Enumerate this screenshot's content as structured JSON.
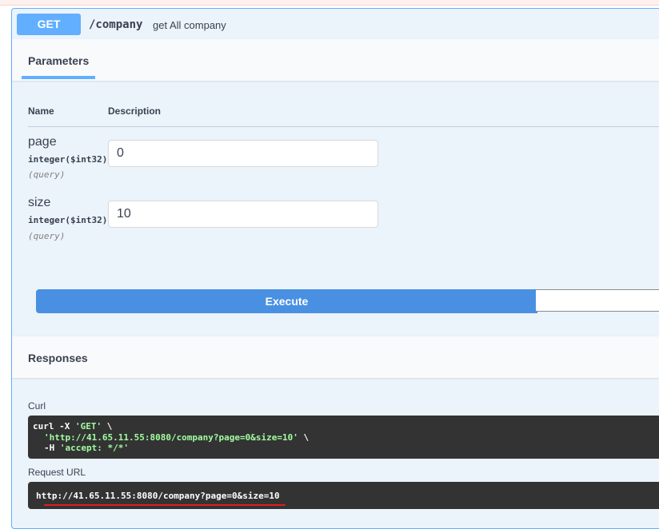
{
  "operation": {
    "method": "GET",
    "path": "/company",
    "summary": "get All company"
  },
  "parameters_tab": {
    "title": "Parameters",
    "column_name": "Name",
    "column_description": "Description",
    "params": [
      {
        "name": "page",
        "type": "integer($int32)",
        "in": "(query)",
        "value": "0"
      },
      {
        "name": "size",
        "type": "integer($int32)",
        "in": "(query)",
        "value": "10"
      }
    ]
  },
  "execute_label": "Execute",
  "responses": {
    "title": "Responses",
    "curl_label": "Curl",
    "curl": {
      "line1_cmd": "curl -X ",
      "line1_method": "'GET'",
      "line1_end": " \\",
      "line2_url": "'http://41.65.11.55:8080/company?page=0&size=10'",
      "line2_end": " \\",
      "line3_flag": "-H ",
      "line3_header": "'accept: */*'"
    },
    "request_url_label": "Request URL",
    "request_url": "http://41.65.11.55:8080/company?page=0&size=10"
  },
  "colors": {
    "get_method": "#61affe",
    "execute": "#4990e2",
    "annotation_red": "#e21d1d",
    "code_bg": "#333333",
    "code_string": "#a2fca2"
  }
}
